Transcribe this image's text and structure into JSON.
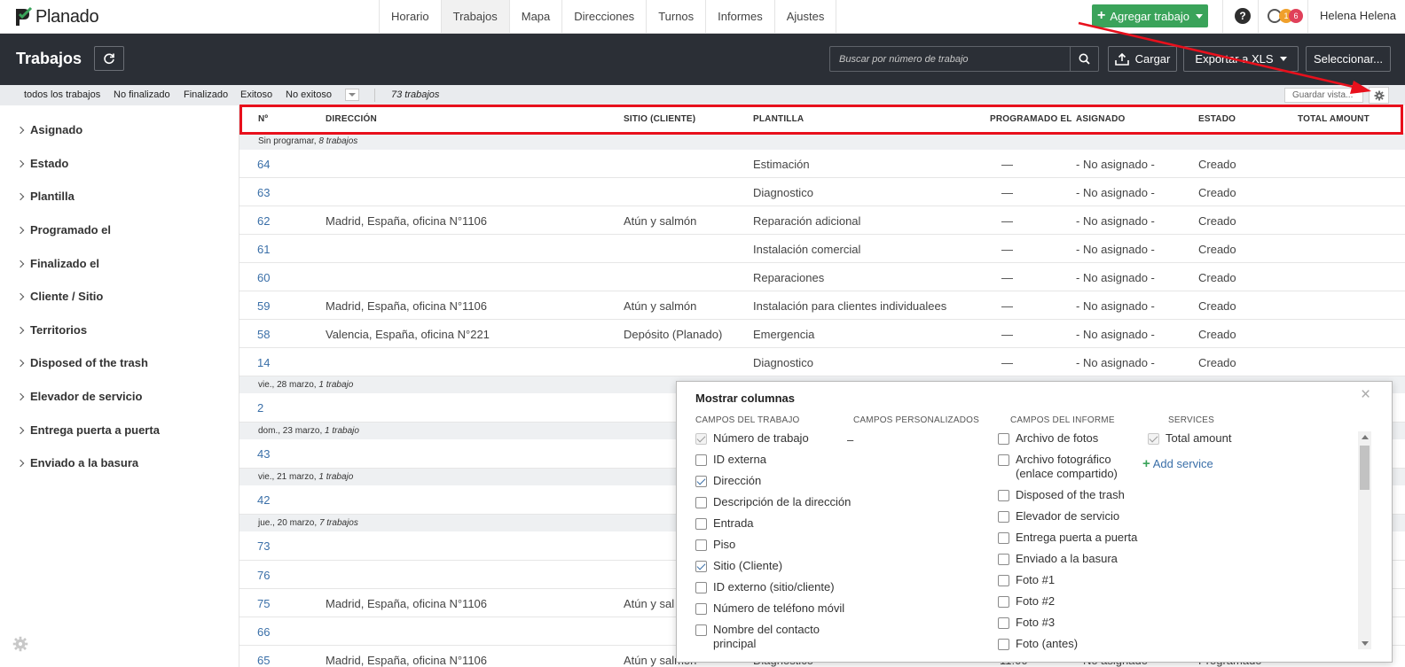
{
  "app": {
    "logo_text": "Planado"
  },
  "topnav": {
    "tabs": [
      {
        "label": "Horario"
      },
      {
        "label": "Trabajos",
        "active": true
      },
      {
        "label": "Mapa"
      },
      {
        "label": "Direcciones"
      },
      {
        "label": "Turnos"
      },
      {
        "label": "Informes"
      },
      {
        "label": "Ajustes"
      }
    ],
    "add_job_label": "Agregar trabajo",
    "help_label": "?",
    "notif_count_1": "1",
    "notif_count_2": "6",
    "user_name": "Helena Helena"
  },
  "header": {
    "title": "Trabajos",
    "search_placeholder": "Buscar por número de trabajo",
    "upload_label": "Cargar",
    "export_label": "Exportar a XLS",
    "select_label": "Seleccionar..."
  },
  "filterbar": {
    "tabs": [
      {
        "label": "todos los trabajos"
      },
      {
        "label": "No finalizado"
      },
      {
        "label": "Finalizado"
      },
      {
        "label": "Exitoso"
      },
      {
        "label": "No exitoso"
      }
    ],
    "count": "73 trabajos",
    "save_view_placeholder": "Guardar vista..."
  },
  "sidebar": {
    "items": [
      {
        "label": "Asignado"
      },
      {
        "label": "Estado"
      },
      {
        "label": "Plantilla"
      },
      {
        "label": "Programado el"
      },
      {
        "label": "Finalizado el"
      },
      {
        "label": "Cliente / Sitio"
      },
      {
        "label": "Territorios"
      },
      {
        "label": "Disposed of the trash"
      },
      {
        "label": "Elevador de servicio"
      },
      {
        "label": "Entrega puerta a puerta"
      },
      {
        "label": "Enviado a la basura"
      }
    ]
  },
  "table": {
    "columns": {
      "num": "Nº",
      "address": "DIRECCIÓN",
      "site": "SITIO (CLIENTE)",
      "template": "PLANTILLA",
      "scheduled": "PROGRAMADO EL",
      "assigned": "ASIGNADO",
      "status": "ESTADO",
      "total": "TOTAL AMOUNT"
    },
    "groups": [
      {
        "label": "Sin programar,",
        "count": "8 trabajos"
      },
      {
        "label": "vie., 28 marzo,",
        "count": "1 trabajo"
      },
      {
        "label": "dom., 23 marzo,",
        "count": "1 trabajo"
      },
      {
        "label": "vie., 21 marzo,",
        "count": "1 trabajo"
      },
      {
        "label": "jue., 20 marzo,",
        "count": "7 trabajos"
      }
    ],
    "rows": [
      {
        "num": "64",
        "address": "",
        "site": "",
        "template": "Estimación",
        "scheduled": "—",
        "assigned": "- No asignado -",
        "status": "Creado"
      },
      {
        "num": "63",
        "address": "",
        "site": "",
        "template": "Diagnostico",
        "scheduled": "—",
        "assigned": "- No asignado -",
        "status": "Creado"
      },
      {
        "num": "62",
        "address": "Madrid, España, oficina N°1106",
        "site": "Atún y salmón",
        "template": "Reparación adicional",
        "scheduled": "—",
        "assigned": "- No asignado -",
        "status": "Creado"
      },
      {
        "num": "61",
        "address": "",
        "site": "",
        "template": "Instalación comercial",
        "scheduled": "—",
        "assigned": "- No asignado -",
        "status": "Creado"
      },
      {
        "num": "60",
        "address": "",
        "site": "",
        "template": "Reparaciones",
        "scheduled": "—",
        "assigned": "- No asignado -",
        "status": "Creado"
      },
      {
        "num": "59",
        "address": "Madrid, España, oficina N°1106",
        "site": "Atún y salmón",
        "template": "Instalación para clientes individualees",
        "scheduled": "—",
        "assigned": "- No asignado -",
        "status": "Creado"
      },
      {
        "num": "58",
        "address": "Valencia, España, oficina N°221",
        "site": "Depósito (Planado)",
        "template": "Emergencia",
        "scheduled": "—",
        "assigned": "- No asignado -",
        "status": "Creado"
      },
      {
        "num": "14",
        "address": "",
        "site": "",
        "template": "Diagnostico",
        "scheduled": "—",
        "assigned": "- No asignado -",
        "status": "Creado"
      },
      {
        "num": "2"
      },
      {
        "num": "43"
      },
      {
        "num": "42"
      },
      {
        "num": "73"
      },
      {
        "num": "76"
      },
      {
        "num": "75",
        "address": "Madrid, España, oficina N°1106",
        "site": "Atún y sal"
      },
      {
        "num": "66"
      },
      {
        "num": "65",
        "address": "Madrid, España, oficina N°1106",
        "site": "Atún y salmón",
        "template": "Diagnostico",
        "scheduled": "11:00",
        "assigned": "- No asignado -",
        "status": "Programado"
      }
    ]
  },
  "columns_dialog": {
    "title": "Mostrar columnas",
    "close": "×",
    "headers": {
      "job": "CAMPOS DEL TRABAJO",
      "custom": "CAMPOS PERSONALIZADOS",
      "report": "CAMPOS DEL INFORME",
      "services": "SERVICES"
    },
    "custom_empty": "–",
    "job_fields": [
      {
        "label": "Número de trabajo",
        "checked": true,
        "disabled": true
      },
      {
        "label": "ID externa",
        "checked": false
      },
      {
        "label": "Dirección",
        "checked": true
      },
      {
        "label": "Descripción de la dirección",
        "checked": false
      },
      {
        "label": "Entrada",
        "checked": false
      },
      {
        "label": "Piso",
        "checked": false
      },
      {
        "label": "Sitio (Cliente)",
        "checked": true
      },
      {
        "label": "ID externo (sitio/cliente)",
        "checked": false
      },
      {
        "label": "Número de teléfono móvil",
        "checked": false
      },
      {
        "label": "Nombre del contacto principal",
        "checked": false
      }
    ],
    "report_fields": [
      {
        "label": "Archivo de fotos",
        "checked": false
      },
      {
        "label": "Archivo fotográfico (enlace compartido)",
        "checked": false
      },
      {
        "label": "Disposed of the trash",
        "checked": false
      },
      {
        "label": "Elevador de servicio",
        "checked": false
      },
      {
        "label": "Entrega puerta a puerta",
        "checked": false
      },
      {
        "label": "Enviado a la basura",
        "checked": false
      },
      {
        "label": "Foto #1",
        "checked": false
      },
      {
        "label": "Foto #2",
        "checked": false
      },
      {
        "label": "Foto #3",
        "checked": false
      },
      {
        "label": "Foto (antes)",
        "checked": false
      }
    ],
    "services": [
      {
        "label": "Total amount",
        "checked": true,
        "disabled": true
      }
    ],
    "add_service_label": "Add service"
  },
  "colors": {
    "dark_header": "#2b2f36",
    "accent_green": "#3aa35a",
    "link_blue": "#3a6fa8",
    "annotation_red": "#e8101c"
  }
}
